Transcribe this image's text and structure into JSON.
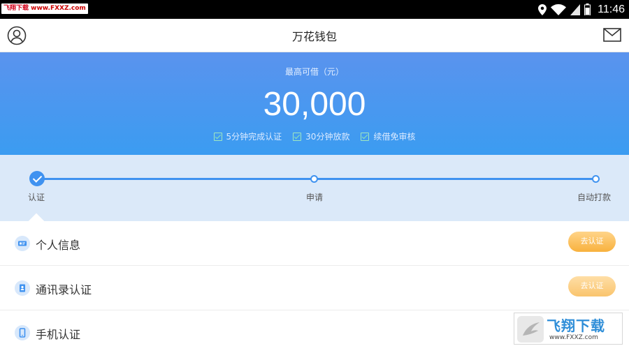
{
  "status_bar": {
    "watermark_prefix": "飞翔下载",
    "watermark_url": "www.FXXZ.com",
    "time": "11:46"
  },
  "app_bar": {
    "title": "万花钱包",
    "left_icon": "user-avatar-icon",
    "right_icon": "mail-icon"
  },
  "hero": {
    "label": "最高可借（元）",
    "amount": "30,000",
    "features": [
      "5分钟完成认证",
      "30分钟放款",
      "续借免审核"
    ]
  },
  "steps": {
    "items": [
      "认证",
      "申请",
      "自动打款"
    ],
    "completed": 1
  },
  "verify_items": [
    {
      "label": "个人信息",
      "icon": "id-card-icon",
      "button": "去认证"
    },
    {
      "label": "通讯录认证",
      "icon": "contacts-icon",
      "button": "去认证"
    },
    {
      "label": "手机认证",
      "icon": "mobile-phone-icon",
      "button": ""
    }
  ],
  "watermark": {
    "name": "飞翔下载",
    "url": "www.FXXZ.com"
  },
  "colors": {
    "primary": "#3f92f0",
    "hero_top": "#5a93ee",
    "button": "#f8b13d",
    "steps_bg": "#dbe9f9"
  }
}
